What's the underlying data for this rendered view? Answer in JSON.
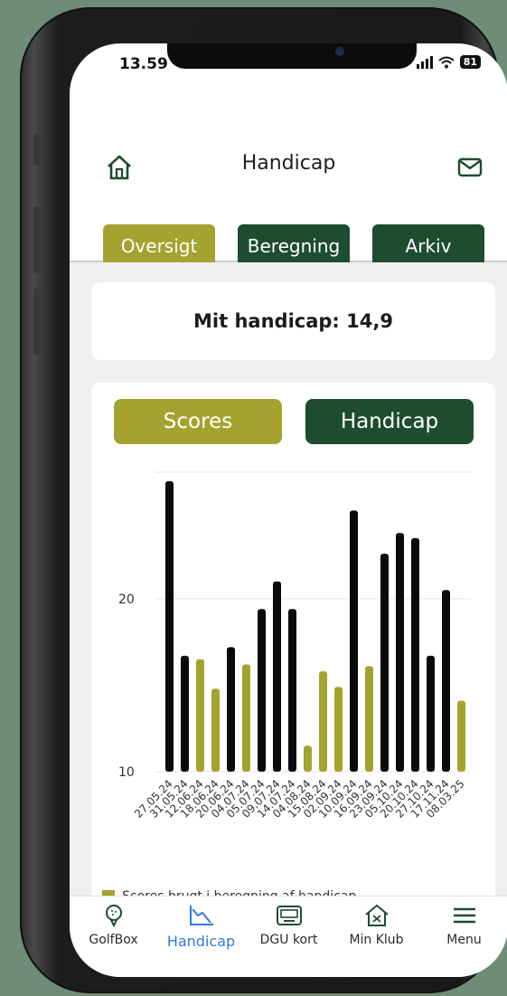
{
  "status": {
    "time": "13.59",
    "battery": "81"
  },
  "header": {
    "title": "Handicap"
  },
  "tabs": [
    {
      "label": "Oversigt",
      "color": "#a5a32f"
    },
    {
      "label": "Beregning",
      "color": "#1d4d2e"
    },
    {
      "label": "Arkiv",
      "color": "#1d4d2e"
    }
  ],
  "handicap_card": {
    "label": "Mit handicap: 14,9"
  },
  "chart_toggle": {
    "scores": "Scores",
    "handicap": "Handicap"
  },
  "legend": {
    "text": "Scores brugt i beregning af handicap"
  },
  "chart_data": {
    "type": "bar",
    "yticks": [
      10,
      20
    ],
    "ylim": [
      10,
      27
    ],
    "categories": [
      "27.05.24",
      "31.05.24",
      "12.06.24",
      "18.06.24",
      "20.06.24",
      "04.07.24",
      "05.07.24",
      "09.07.24",
      "14.07.24",
      "04.08.24",
      "15.08.24",
      "02.09.24",
      "10.09.24",
      "16.09.24",
      "23.09.24",
      "05.10.24",
      "20.10.24",
      "27.10.24",
      "17.11.24",
      "08.03.25"
    ],
    "values": [
      26.8,
      16.7,
      16.5,
      14.8,
      17.2,
      16.2,
      19.4,
      21.0,
      19.4,
      11.5,
      15.8,
      14.9,
      25.1,
      16.1,
      22.6,
      23.8,
      23.5,
      16.7,
      20.5,
      14.1
    ],
    "highlighted": [
      false,
      false,
      true,
      true,
      false,
      true,
      false,
      false,
      false,
      true,
      true,
      true,
      false,
      true,
      false,
      false,
      false,
      false,
      false,
      true
    ],
    "colors": {
      "default": "#0a0a0a",
      "highlight": "#a5a32f"
    }
  },
  "bottom_nav": [
    {
      "label": "GolfBox",
      "icon": "golfball-icon",
      "active": false
    },
    {
      "label": "Handicap",
      "icon": "chart-line-icon",
      "active": true
    },
    {
      "label": "DGU kort",
      "icon": "card-icon",
      "active": false
    },
    {
      "label": "Min Klub",
      "icon": "club-home-icon",
      "active": false
    },
    {
      "label": "Menu",
      "icon": "hamburger-icon",
      "active": false
    }
  ]
}
